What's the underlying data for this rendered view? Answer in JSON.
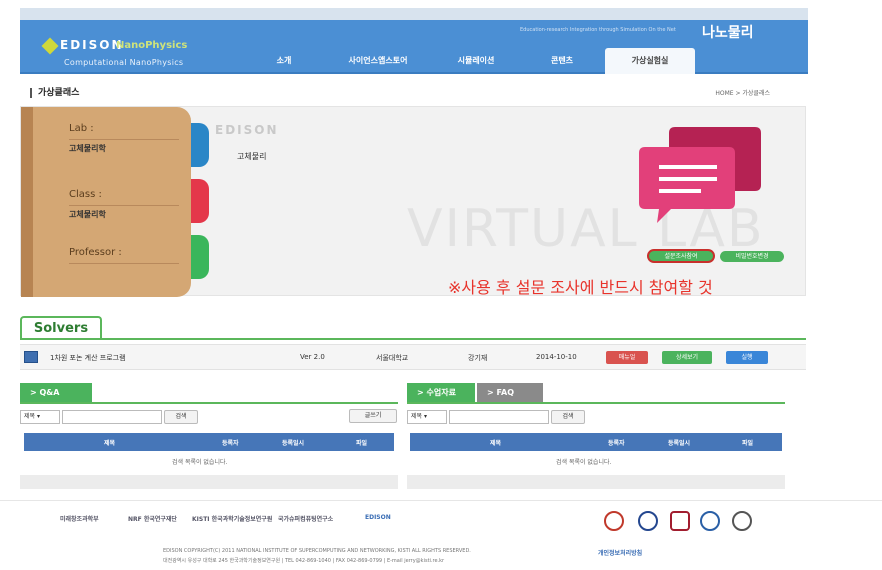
{
  "header": {
    "logo_edison": "EDISON",
    "logo_product": "NanoPhysics",
    "logo_subtitle": "Computational NanoPhysics",
    "tagline": "Education-research Integration through Simulation On the Net",
    "brand_kr": "나노물리"
  },
  "nav": [
    {
      "label": "소개",
      "active": false
    },
    {
      "label": "사이언스앱스토어",
      "active": false
    },
    {
      "label": "시뮬레이션",
      "active": false
    },
    {
      "label": "콘텐츠",
      "active": false
    },
    {
      "label": "가상실험실",
      "active": true
    }
  ],
  "page": {
    "title": "가상클래스",
    "breadcrumb": "HOME > 가상클래스"
  },
  "lab": {
    "lab_label": "Lab :",
    "lab_value": "고체물리학",
    "class_label": "Class :",
    "class_value": "고체물리학",
    "professor_label": "Professor :",
    "page_edison": "EDISON",
    "page_text": "고체물리",
    "bg_text": "VIRTUAL LAB",
    "survey_button": "설문조사참여",
    "password_button": "비밀번호변경",
    "accent_colors": {
      "blue": "#2a86c7",
      "red": "#e4374a",
      "green": "#3ab65b"
    }
  },
  "notice": "※사용 후 설문 조사에 반드시 참여할 것",
  "solvers": {
    "tab_label": "Solvers",
    "row": {
      "name": "1차원 포논 계산 프로그램",
      "version": "Ver 2.0",
      "org": "서울대학교",
      "author": "강기재",
      "date": "2014-10-10",
      "manual_button": "매뉴얼",
      "detail_button": "상세보기",
      "run_button": "실행"
    }
  },
  "qna": {
    "tab_label": "> Q&A",
    "select_value": "제목",
    "search_button": "검색",
    "write_button": "글쓰기",
    "columns": [
      "제목",
      "등록자",
      "등록일시",
      "파일"
    ],
    "empty_text": "검색 목록이 없습니다."
  },
  "materials": {
    "tab_label": "> 수업자료",
    "tab2_label": "> FAQ",
    "select_value": "제목",
    "search_button": "검색",
    "columns": [
      "제목",
      "등록자",
      "등록일시",
      "파일"
    ],
    "empty_text": "검색 목록이 없습니다."
  },
  "footer": {
    "logos": [
      "미래창조과학부",
      "NRF 한국연구재단",
      "KISTI 한국과학기술정보연구원",
      "국가슈퍼컴퓨팅연구소",
      "EDISON"
    ],
    "copyright": "EDISON COPYRIGHT(C) 2011 NATIONAL INSTITUTE OF SUPERCOMPUTING AND NETWORKING, KISTI ALL RIGHTS RESERVED.",
    "address": "대전광역시 유성구 대학로 245 한국과학기술정보연구원 | TEL 042-869-1040 | FAX 042-869-0799 | E-mail jerry@kisti.re.kr",
    "privacy": "개인정보처리방침"
  }
}
